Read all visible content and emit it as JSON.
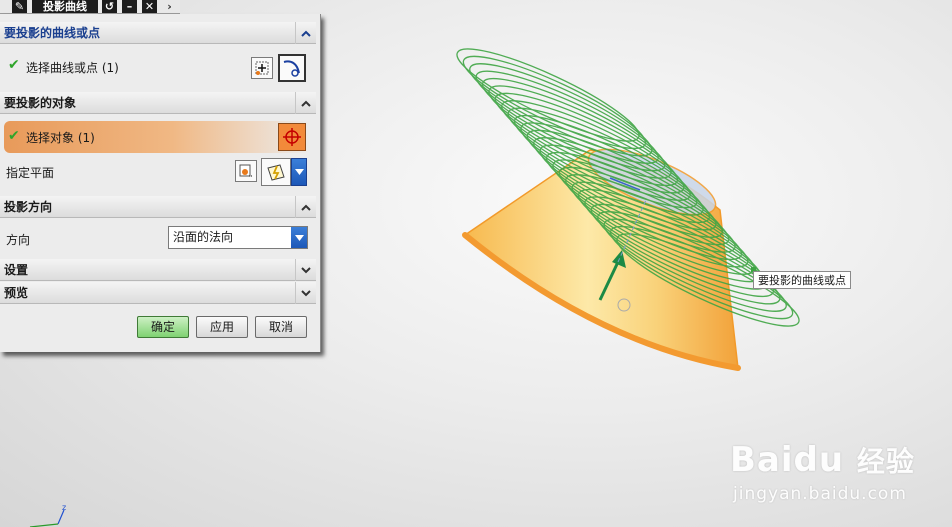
{
  "window": {
    "title": "投影曲线",
    "pin_icon": "pin-icon",
    "reset_icon": "reset-icon",
    "minimize_icon": "minimize-icon",
    "close_icon": "close-icon",
    "expand_icon": "chevron-right-icon"
  },
  "dialog": {
    "curves_section": {
      "title": "要投影的曲线或点",
      "select_label": "选择曲线或点 (1)",
      "buttons": [
        "add-curve-icon",
        "curve-select-icon"
      ]
    },
    "objects_section": {
      "title": "要投影的对象",
      "select_label": "选择对象 (1)",
      "plane_label": "指定平面",
      "buttons": [
        "crosshair-icon",
        "plane-dialog-icon",
        "plane-select-icon"
      ]
    },
    "direction_section": {
      "title": "投影方向",
      "direction_label": "方向",
      "direction_value": "沿面的法向"
    },
    "settings_section": {
      "title": "设置"
    },
    "preview_section": {
      "title": "预览"
    },
    "actions": {
      "ok": "确定",
      "apply": "应用",
      "cancel": "取消"
    }
  },
  "viewport": {
    "tooltip": "要投影的曲线或点",
    "axis_label": "z",
    "colors": {
      "helix": "#3fa544",
      "cone": "#f4a640",
      "selection": "#f0b070",
      "accent_blue": "#1a3f8f"
    }
  },
  "watermark": {
    "brand": "Baidu",
    "sub": "经验",
    "url": "jingyan.baidu.com"
  }
}
